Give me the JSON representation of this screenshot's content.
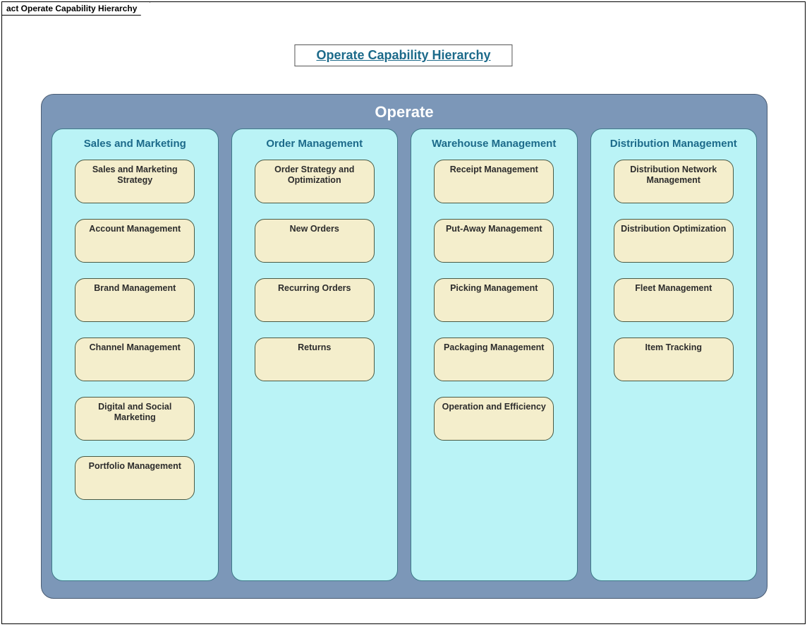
{
  "frame_tab": "act Operate Capability Hierarchy",
  "title": "Operate Capability Hierarchy",
  "operate_label": "Operate",
  "columns": [
    {
      "title": "Sales and Marketing",
      "items": [
        "Sales and Marketing Strategy",
        "Account Management",
        "Brand Management",
        "Channel Management",
        "Digital and Social Marketing",
        "Portfolio Management"
      ]
    },
    {
      "title": "Order Management",
      "items": [
        "Order Strategy and Optimization",
        "New Orders",
        "Recurring Orders",
        "Returns"
      ]
    },
    {
      "title": "Warehouse Management",
      "items": [
        "Receipt Management",
        "Put-Away Management",
        "Picking Management",
        "Packaging Management",
        "Operation and Efficiency"
      ]
    },
    {
      "title": "Distribution Management",
      "items": [
        "Distribution Network Management",
        "Distribution Optimization",
        "Fleet Management",
        "Item Tracking"
      ]
    }
  ]
}
